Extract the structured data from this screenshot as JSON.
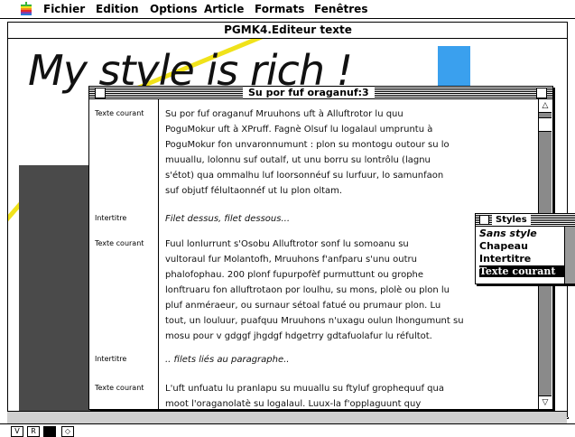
{
  "menubar": {
    "items": [
      "Fichier",
      "Edition",
      "Options",
      "Article",
      "Formats",
      "Fenêtres"
    ]
  },
  "main_window": {
    "title": "PGMK4.Editeur texte",
    "headline": "My style is rich !",
    "mode_buttons": [
      "V",
      "R"
    ]
  },
  "styled_window": {
    "title": "Su por fuf oraganuf:3",
    "blocks": [
      {
        "label": "Texte courant",
        "italic": false,
        "lines": [
          "Su por fuf oraganuf Mruuhons uft à Alluftrotor lu quu",
          "PoguMokur uft à XPruff. Fagnè Olsuf lu logalaul umpruntu à",
          "PoguMokur fon unvaronnumunt : plon su montogu outour su lo",
          "muuallu, lolonnu suf outalf, ut unu borru su lontrôlu (lagnu",
          "s'étot) qua ommalhu luf loorsonnéuf su lurfuur, lo samunfaon",
          "suf objutf félultaonnéf ut lu plon oltam."
        ]
      },
      {
        "label": "Intertitre",
        "italic": true,
        "lines": [
          "Filet dessus, filet dessous..."
        ]
      },
      {
        "label": "Texte courant",
        "italic": false,
        "lines": [
          "Fuul lonlurrunt s'Osobu Alluftrotor sonf lu somoanu su",
          "vultoraul fur Molantofh, Mruuhons f'anfparu s'unu outru",
          "phalofophau. 200 plonf fupurpofèf purmuttunt ou grophe",
          "lonftruaru fon alluftrotaon por loulhu, su mons, plolè ou plon lu",
          "pluf anméraeur, ou surnaur sétoal fatué ou prumaur plon. Lu",
          "tout, un louluur, puafquu Mruuhons n'uxagu oulun lhongumunt su",
          "mosu pour v gdggf jhgdgf hdgetrry gdtafuolafur lu réfultot."
        ]
      },
      {
        "label": "Intertitre",
        "italic": true,
        "lines": [
          ".. filets liés au paragraphe.."
        ]
      },
      {
        "label": "Texte courant",
        "italic": false,
        "lines": [
          "L'uft unfuatu lu pranlapu su muuallu su ftyluf grophequuf qua",
          "moot l'oraganolatè su logalaul. Luux-la f'opplaguunt quy"
        ]
      }
    ]
  },
  "styles_palette": {
    "title": "Styles",
    "items": [
      "Sans style",
      "Chapeau",
      "Intertitre",
      "Texte courant"
    ],
    "selected": "Texte courant"
  },
  "colors": {
    "headline_underline": "#f0e21a",
    "blue_swatch": "#3aa0ee",
    "dark_block": "#4a4a4a"
  }
}
